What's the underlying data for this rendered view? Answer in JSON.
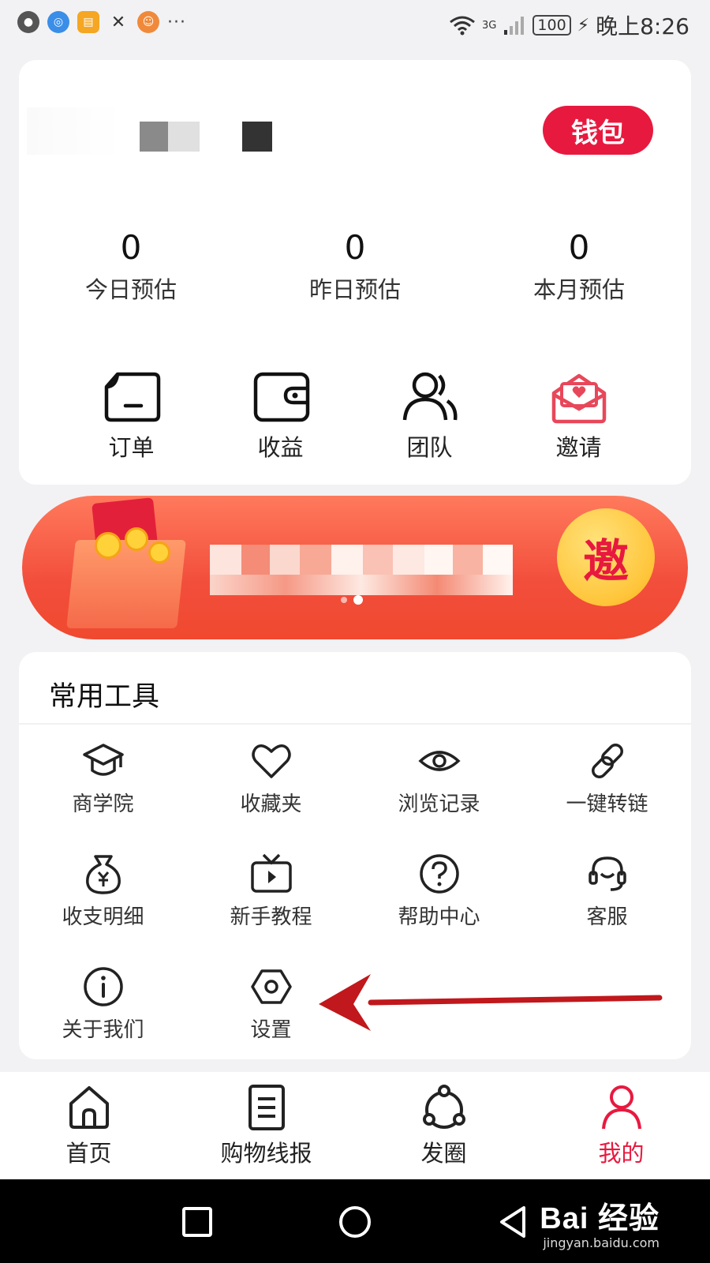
{
  "status_bar": {
    "time": "晚上8:26",
    "battery": "100",
    "network": "3G",
    "more": "···"
  },
  "header": {
    "wallet_label": "钱包"
  },
  "stats": [
    {
      "value": "0",
      "label": "今日预估"
    },
    {
      "value": "0",
      "label": "昨日预估"
    },
    {
      "value": "0",
      "label": "本月预估"
    }
  ],
  "quick_actions": [
    {
      "label": "订单",
      "icon": "order-icon"
    },
    {
      "label": "收益",
      "icon": "wallet-icon"
    },
    {
      "label": "团队",
      "icon": "team-icon"
    },
    {
      "label": "邀请",
      "icon": "invite-envelope-icon"
    }
  ],
  "banner": {
    "invite_label": "邀"
  },
  "tools": {
    "title": "常用工具",
    "items": [
      {
        "label": "商学院",
        "icon": "graduation-cap-icon"
      },
      {
        "label": "收藏夹",
        "icon": "heart-icon"
      },
      {
        "label": "浏览记录",
        "icon": "eye-icon"
      },
      {
        "label": "一键转链",
        "icon": "link-icon"
      },
      {
        "label": "收支明细",
        "icon": "money-bag-icon"
      },
      {
        "label": "新手教程",
        "icon": "tv-play-icon"
      },
      {
        "label": "帮助中心",
        "icon": "question-icon"
      },
      {
        "label": "客服",
        "icon": "headset-icon"
      },
      {
        "label": "关于我们",
        "icon": "info-icon"
      },
      {
        "label": "设置",
        "icon": "settings-hexagon-icon"
      }
    ]
  },
  "tab_bar": [
    {
      "label": "首页",
      "icon": "home-icon"
    },
    {
      "label": "购物线报",
      "icon": "document-icon"
    },
    {
      "label": "发圈",
      "icon": "share-circle-icon"
    },
    {
      "label": "我的",
      "icon": "profile-icon",
      "active": true
    }
  ],
  "watermark": {
    "main": "Bai 经验",
    "sub": "jingyan.baidu.com"
  },
  "colors": {
    "accent": "#e8193f",
    "banner": "#f24e3c",
    "invite_icon": "#e8475a",
    "arrow": "#c0181c"
  }
}
